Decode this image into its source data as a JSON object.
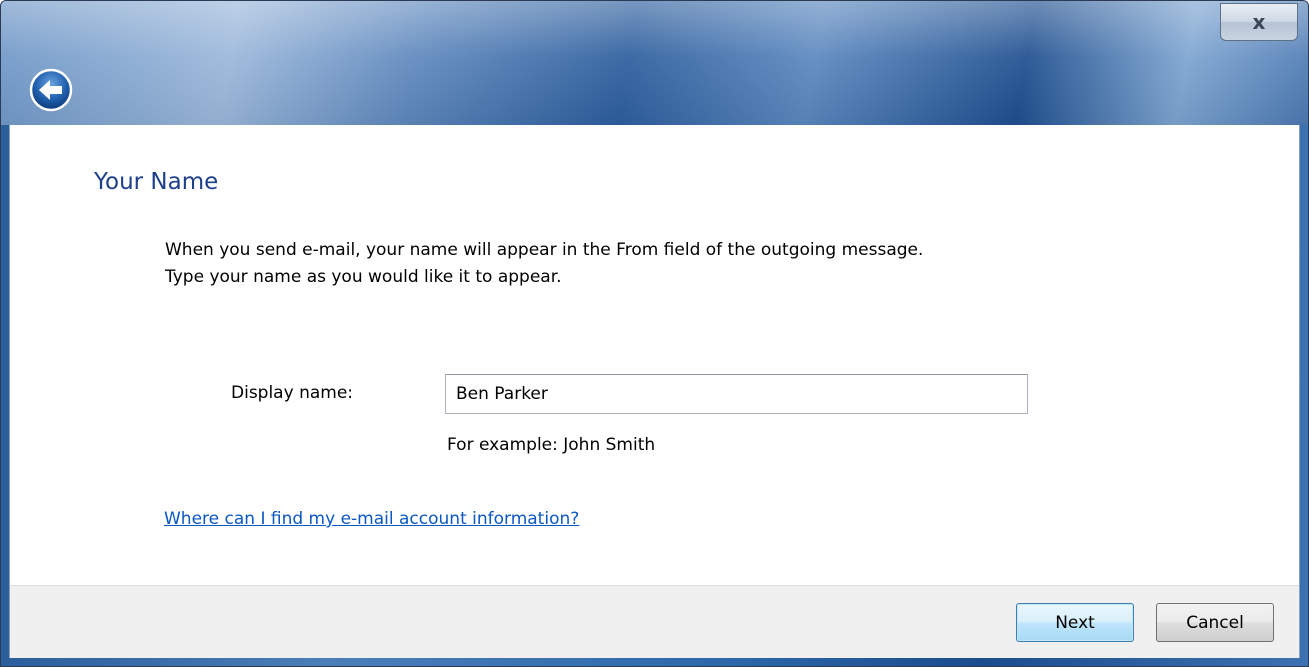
{
  "titlebar": {
    "close_label": "x",
    "back_icon": "back-arrow-icon"
  },
  "page": {
    "title": "Your Name",
    "description_line1": "When you send e-mail, your name will appear in the From field of the outgoing message.",
    "description_line2": "Type your name as you would like it to appear."
  },
  "form": {
    "display_name_label": "Display name:",
    "display_name_value": "Ben Parker",
    "example_text": "For example: John Smith"
  },
  "help_link": "Where can I find my e-mail account information?",
  "footer": {
    "next_label": "Next",
    "cancel_label": "Cancel"
  },
  "colors": {
    "title_text": "#1e3f8a",
    "link": "#0b57c4",
    "footer_bg": "#f0f0f0"
  }
}
